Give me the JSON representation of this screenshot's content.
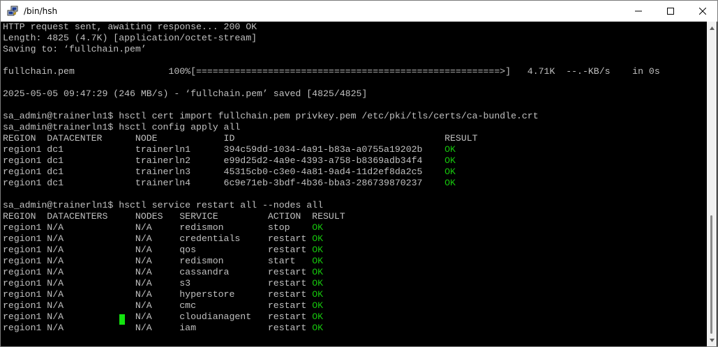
{
  "window": {
    "title": "/bin/hsh",
    "app_icon": "putty-icon",
    "buttons": {
      "minimize": "minimize-icon",
      "maximize": "maximize-icon",
      "close": "close-icon"
    }
  },
  "terminal": {
    "lines": [
      "HTTP request sent, awaiting response... 200 OK",
      "Length: 4825 (4.7K) [application/octet-stream]",
      "Saving to: ‘fullchain.pem’",
      "",
      "fullchain.pem                 100%[=======================================================>]   4.71K  --.-KB/s    in 0s",
      "",
      "2025-05-05 09:47:29 (246 MB/s) - ‘fullchain.pem’ saved [4825/4825]",
      "",
      "sa_admin@trainerln1$ hsctl cert import fullchain.pem privkey.pem /etc/pki/tls/certs/ca-bundle.crt",
      "sa_admin@trainerln1$ hsctl config apply all",
      "REGION  DATACENTER      NODE            ID                                      RESULT",
      "region1 dc1             trainerln1      394c59dd-1034-4a91-b83a-a0755a19202b    ",
      "region1 dc1             trainerln2      e99d25d2-4a9e-4393-a758-b8369adb34f4    ",
      "region1 dc1             trainerln3      45315cb0-c3e0-4a81-9ad4-11d2ef8da2c5    ",
      "region1 dc1             trainerln4      6c9e71eb-3bdf-4b36-bba3-286739870237    ",
      "",
      "sa_admin@trainerln1$ hsctl service restart all --nodes all",
      "REGION  DATACENTERS     NODES   SERVICE         ACTION  RESULT",
      "region1 N/A             N/A     redismon        stop    ",
      "region1 N/A             N/A     credentials     restart ",
      "region1 N/A             N/A     qos             restart ",
      "region1 N/A             N/A     redismon        start   ",
      "region1 N/A             N/A     cassandra       restart ",
      "region1 N/A             N/A     s3              restart ",
      "region1 N/A             N/A     hyperstore      restart ",
      "region1 N/A             N/A     cmc             restart ",
      "region1 N/A             N/A     cloudianagent   restart ",
      "region1 N/A             N/A     iam             restart "
    ],
    "ok_marks": [
      null,
      null,
      null,
      null,
      null,
      null,
      null,
      null,
      null,
      null,
      null,
      "OK",
      "OK",
      "OK",
      "OK",
      null,
      null,
      null,
      "OK",
      "OK",
      "OK",
      "OK",
      "OK",
      "OK",
      "OK",
      "OK",
      "OK",
      "OK"
    ],
    "colors": {
      "text": "#c0c0c0",
      "ok": "#16c60c",
      "cursor": "#13e30f",
      "background": "#000000"
    }
  },
  "scrollbar": {
    "up_icon": "scroll-up-arrow-icon",
    "down_icon": "scroll-down-arrow-icon"
  }
}
